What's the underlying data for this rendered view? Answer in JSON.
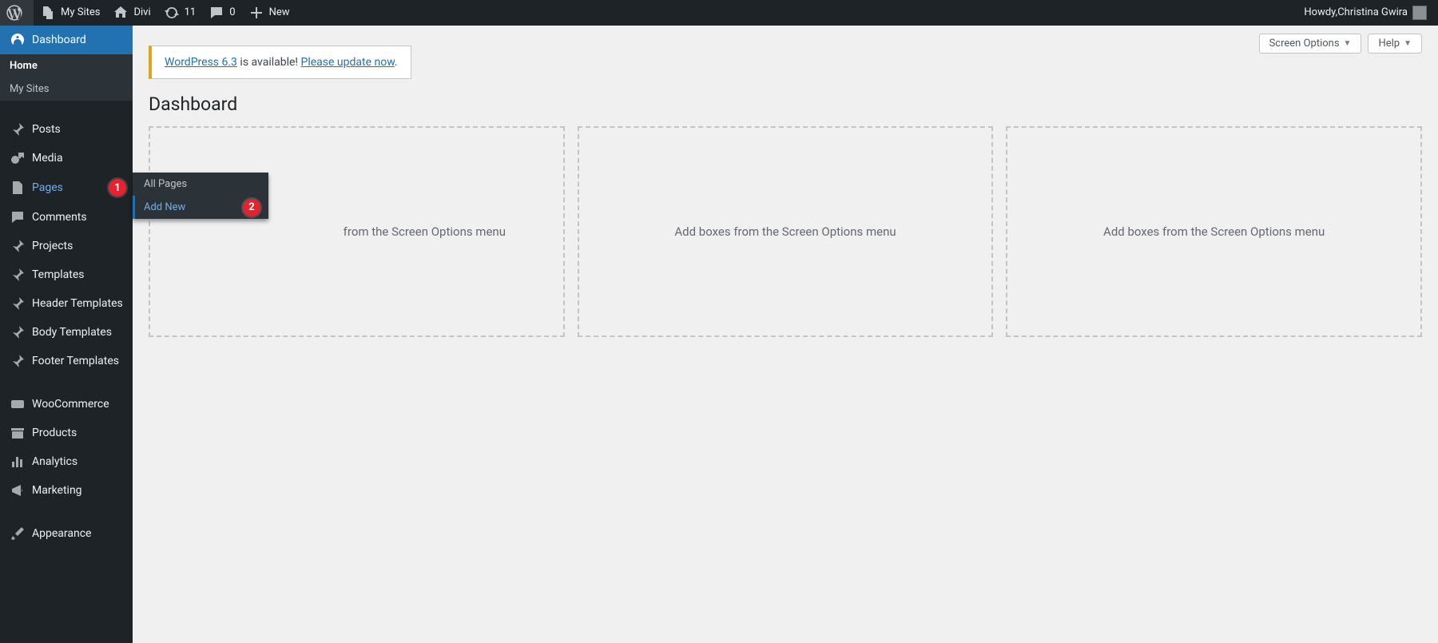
{
  "adminbar": {
    "my_sites": "My Sites",
    "site_name": "Divi",
    "updates_count": "11",
    "comments_count": "0",
    "new_label": "New",
    "howdy_prefix": "Howdy, ",
    "user_name": "Christina Gwira"
  },
  "sidebar": {
    "items": [
      {
        "key": "dashboard",
        "label": "Dashboard"
      },
      {
        "key": "posts",
        "label": "Posts"
      },
      {
        "key": "media",
        "label": "Media"
      },
      {
        "key": "pages",
        "label": "Pages"
      },
      {
        "key": "comments",
        "label": "Comments"
      },
      {
        "key": "projects",
        "label": "Projects"
      },
      {
        "key": "templates",
        "label": "Templates"
      },
      {
        "key": "header_templates",
        "label": "Header Templates"
      },
      {
        "key": "body_templates",
        "label": "Body Templates"
      },
      {
        "key": "footer_templates",
        "label": "Footer Templates"
      },
      {
        "key": "woocommerce",
        "label": "WooCommerce"
      },
      {
        "key": "products",
        "label": "Products"
      },
      {
        "key": "analytics",
        "label": "Analytics"
      },
      {
        "key": "marketing",
        "label": "Marketing"
      },
      {
        "key": "appearance",
        "label": "Appearance"
      }
    ],
    "dashboard_sub": {
      "home": "Home",
      "my_sites": "My Sites"
    },
    "pages_flyout": {
      "all_pages": "All Pages",
      "add_new": "Add New"
    }
  },
  "annotations": {
    "one": "1",
    "two": "2"
  },
  "content": {
    "update_link1": "WordPress 6.3",
    "update_mid": " is available! ",
    "update_link2": "Please update now",
    "update_end": ".",
    "page_title": "Dashboard",
    "screen_options": "Screen Options",
    "help": "Help",
    "box_text": "Add boxes from the Screen Options menu",
    "box_text_clipped": "from the Screen Options menu"
  }
}
